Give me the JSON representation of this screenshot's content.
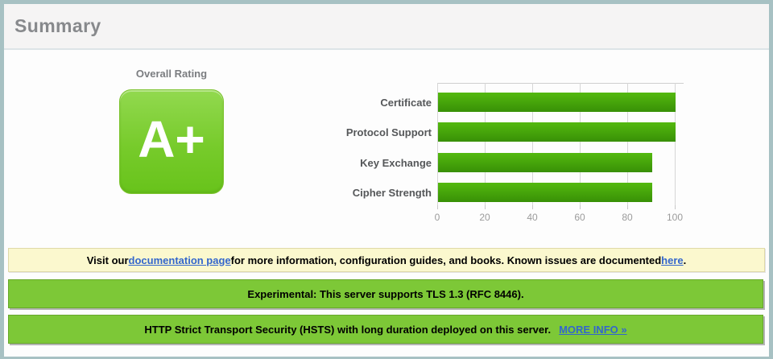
{
  "header": {
    "title": "Summary"
  },
  "overall_rating": {
    "label": "Overall Rating",
    "grade": "A+"
  },
  "chart_data": {
    "type": "bar",
    "orientation": "horizontal",
    "categories": [
      "Certificate",
      "Protocol Support",
      "Key Exchange",
      "Cipher Strength"
    ],
    "values": [
      100,
      100,
      90,
      90
    ],
    "xlim": [
      0,
      100
    ],
    "ticks": [
      0,
      20,
      40,
      60,
      80,
      100
    ],
    "grid": true,
    "title": "",
    "xlabel": "",
    "ylabel": "",
    "legend": null
  },
  "notices": {
    "documentation": {
      "text_before": "Visit our ",
      "link1": "documentation page",
      "text_middle": " for more information, configuration guides, and books. Known issues are documented ",
      "link2": "here",
      "text_after": "."
    },
    "experimental": {
      "text": "Experimental: This server supports TLS 1.3 (RFC 8446)."
    },
    "hsts": {
      "text": "HTTP Strict Transport Security (HSTS) with long duration deployed on this server.",
      "link": "MORE INFO »"
    }
  },
  "colors": {
    "accent_green": "#7dc837",
    "badge_green_top": "#92d94f",
    "badge_green_bottom": "#68c31b",
    "bar_green_top": "#54b90f",
    "bar_green_bottom": "#389006",
    "notice_yellow": "#fbf8ce",
    "link_blue": "#3366cc"
  }
}
